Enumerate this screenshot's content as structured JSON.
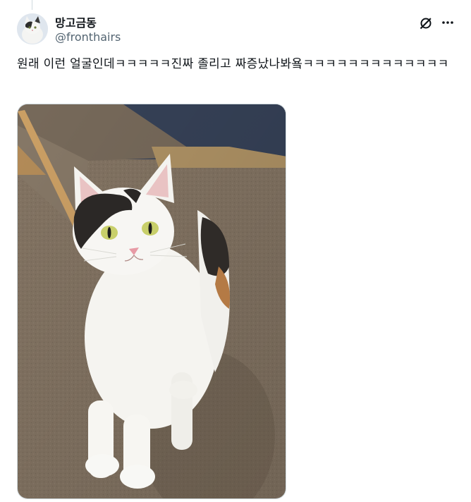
{
  "tweet": {
    "author": {
      "display_name": "망고금동",
      "handle": "@fronthairs",
      "avatar_icon": "cat-avatar"
    },
    "text": "원래 이런 얼굴인데ㅋㅋㅋㅋㅋ진짜 졸리고 짜증났나봐욬ㅋㅋㅋㅋㅋㅋㅋㅋㅋㅋㅋㅋㅋ",
    "media": {
      "type": "photo",
      "subject": "calico cat standing on carpet"
    },
    "actions": {
      "grok_icon": "grok-icon",
      "more_icon": "more-dots-icon"
    }
  },
  "colors": {
    "text_primary": "#0f1419",
    "text_secondary": "#536471",
    "border": "#cfd9de"
  }
}
